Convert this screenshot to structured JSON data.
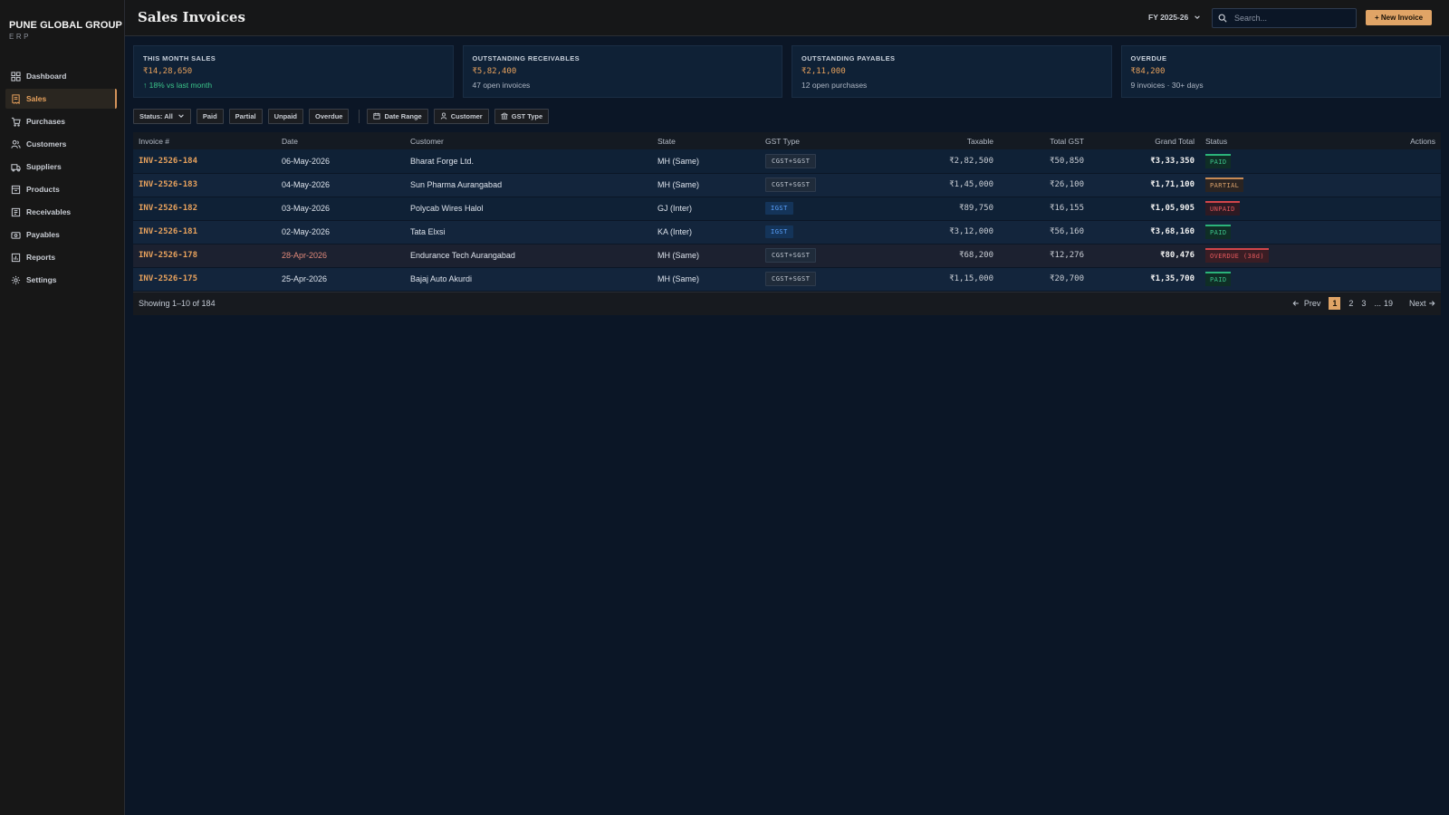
{
  "brand": {
    "name": "PUNE GLOBAL GROUP",
    "sub": "ERP"
  },
  "sidebar": {
    "items": [
      {
        "label": "Dashboard",
        "icon": "dashboard-icon",
        "active": false
      },
      {
        "label": "Sales",
        "icon": "receipt-icon",
        "active": true
      },
      {
        "label": "Purchases",
        "icon": "cart-icon",
        "active": false
      },
      {
        "label": "Customers",
        "icon": "users-icon",
        "active": false
      },
      {
        "label": "Suppliers",
        "icon": "truck-icon",
        "active": false
      },
      {
        "label": "Products",
        "icon": "box-icon",
        "active": false
      },
      {
        "label": "Receivables",
        "icon": "receivable-icon",
        "active": false
      },
      {
        "label": "Payables",
        "icon": "wallet-icon",
        "active": false
      },
      {
        "label": "Reports",
        "icon": "report-icon",
        "active": false
      },
      {
        "label": "Settings",
        "icon": "gear-icon",
        "active": false
      }
    ]
  },
  "header": {
    "title": "Sales Invoices",
    "fy": "FY 2025-26",
    "search_placeholder": "Search...",
    "new_button": "+ New Invoice"
  },
  "stats": [
    {
      "label": "THIS MONTH SALES",
      "value": "₹14,28,650",
      "sub": "↑ 18% vs last month",
      "trend": "up"
    },
    {
      "label": "OUTSTANDING RECEIVABLES",
      "value": "₹5,82,400",
      "sub": "47 open invoices",
      "trend": ""
    },
    {
      "label": "OUTSTANDING PAYABLES",
      "value": "₹2,11,000",
      "sub": "12 open purchases",
      "trend": ""
    },
    {
      "label": "OVERDUE",
      "value": "₹84,200",
      "sub": "9 invoices · 30+ days",
      "trend": ""
    }
  ],
  "filters": {
    "status": "Status: All",
    "chips": [
      "Paid",
      "Partial",
      "Unpaid",
      "Overdue"
    ],
    "date_range": "Date Range",
    "customer": "Customer",
    "gst_type": "GST Type"
  },
  "table": {
    "columns": [
      "Invoice #",
      "Date",
      "Customer",
      "State",
      "GST Type",
      "Taxable",
      "Total GST",
      "Grand Total",
      "Status",
      "Actions"
    ],
    "rows": [
      {
        "invoice": "INV-2526-184",
        "date": "06-May-2026",
        "customer": "Bharat Forge Ltd.",
        "state": "MH (Same)",
        "gst": "CGST+SGST",
        "taxable": "₹2,82,500",
        "total_gst": "₹50,850",
        "grand": "₹3,33,350",
        "status": "PAID",
        "status_kind": "paid",
        "gst_kind": "cs"
      },
      {
        "invoice": "INV-2526-183",
        "date": "04-May-2026",
        "customer": "Sun Pharma Aurangabad",
        "state": "MH (Same)",
        "gst": "CGST+SGST",
        "taxable": "₹1,45,000",
        "total_gst": "₹26,100",
        "grand": "₹1,71,100",
        "status": "PARTIAL",
        "status_kind": "partial",
        "gst_kind": "cs"
      },
      {
        "invoice": "INV-2526-182",
        "date": "03-May-2026",
        "customer": "Polycab Wires Halol",
        "state": "GJ (Inter)",
        "gst": "IGST",
        "taxable": "₹89,750",
        "total_gst": "₹16,155",
        "grand": "₹1,05,905",
        "status": "UNPAID",
        "status_kind": "unpaid",
        "gst_kind": "ig"
      },
      {
        "invoice": "INV-2526-181",
        "date": "02-May-2026",
        "customer": "Tata Elxsi",
        "state": "KA (Inter)",
        "gst": "IGST",
        "taxable": "₹3,12,000",
        "total_gst": "₹56,160",
        "grand": "₹3,68,160",
        "status": "PAID",
        "status_kind": "paid",
        "gst_kind": "ig"
      },
      {
        "invoice": "INV-2526-178",
        "date": "28-Apr-2026",
        "customer": "Endurance Tech Aurangabad",
        "state": "MH (Same)",
        "gst": "CGST+SGST",
        "taxable": "₹68,200",
        "total_gst": "₹12,276",
        "grand": "₹80,476",
        "status": "OVERDUE (38d)",
        "status_kind": "overdue",
        "gst_kind": "cs"
      },
      {
        "invoice": "INV-2526-175",
        "date": "25-Apr-2026",
        "customer": "Bajaj Auto Akurdi",
        "state": "MH (Same)",
        "gst": "CGST+SGST",
        "taxable": "₹1,15,000",
        "total_gst": "₹20,700",
        "grand": "₹1,35,700",
        "status": "PAID",
        "status_kind": "paid",
        "gst_kind": "cs"
      }
    ]
  },
  "footer": {
    "showing": "Showing 1–10 of 184",
    "prev": "Prev",
    "pages": [
      "1",
      "2",
      "3",
      "...",
      "19"
    ],
    "next": "Next"
  }
}
